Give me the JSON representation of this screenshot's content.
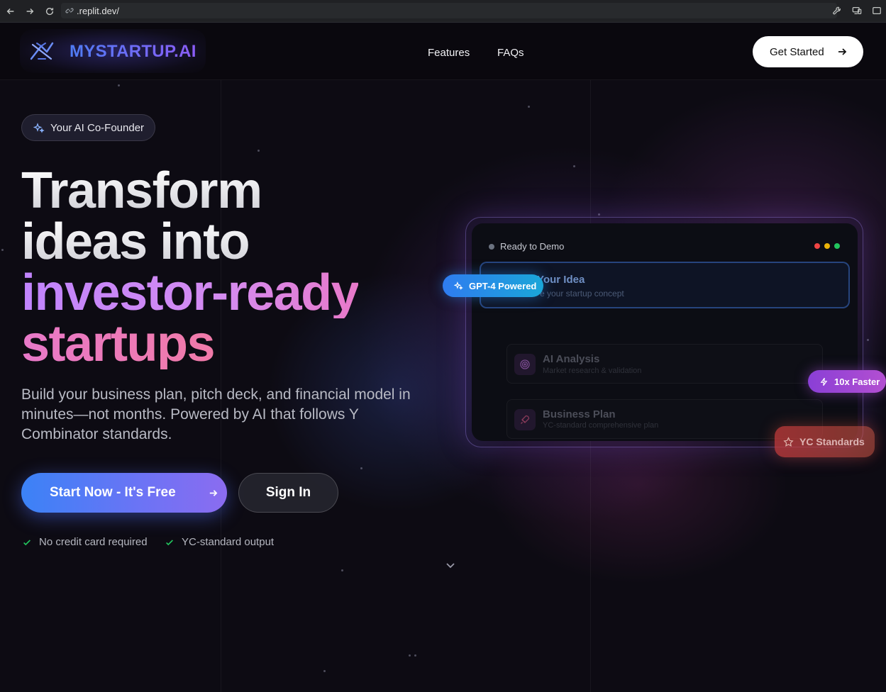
{
  "browser": {
    "url": ".replit.dev/"
  },
  "header": {
    "brand": "MYSTARTUP.AI",
    "nav": [
      {
        "label": "Features"
      },
      {
        "label": "FAQs"
      }
    ],
    "cta_label": "Get Started"
  },
  "hero": {
    "badge": "Your AI Co-Founder",
    "headline": [
      "Transform",
      "ideas into",
      "investor-ready",
      "startups"
    ],
    "subtitle": "Build your business plan, pitch deck, and financial model in minutes—not months. Powered by AI that follows Y Combinator standards.",
    "primary_button": "Start Now - It's Free",
    "secondary_button": "Sign In",
    "checks": [
      "No credit card required",
      "YC-standard output"
    ]
  },
  "demo": {
    "status": "Ready to Demo",
    "traffic_colors": [
      "#ef4444",
      "#eab308",
      "#22c55e"
    ],
    "steps": [
      {
        "title": "Input Your Idea",
        "title_visible": "ut Your Idea",
        "desc": "e your startup concept"
      },
      {
        "title": "AI Analysis",
        "desc": "Market research & validation",
        "icon": "target-icon"
      },
      {
        "title": "Business Plan",
        "desc": "YC-standard comprehensive plan",
        "icon": "rocket-icon"
      }
    ],
    "tags": {
      "gpt": "GPT-4 Powered",
      "fast": "10x Faster",
      "yc": "YC Standards"
    }
  },
  "colors": {
    "accent_blue": "#3b82f6",
    "accent_purple": "#8b5cf6",
    "accent_pink": "#e879c9",
    "background": "#0d0b13"
  }
}
